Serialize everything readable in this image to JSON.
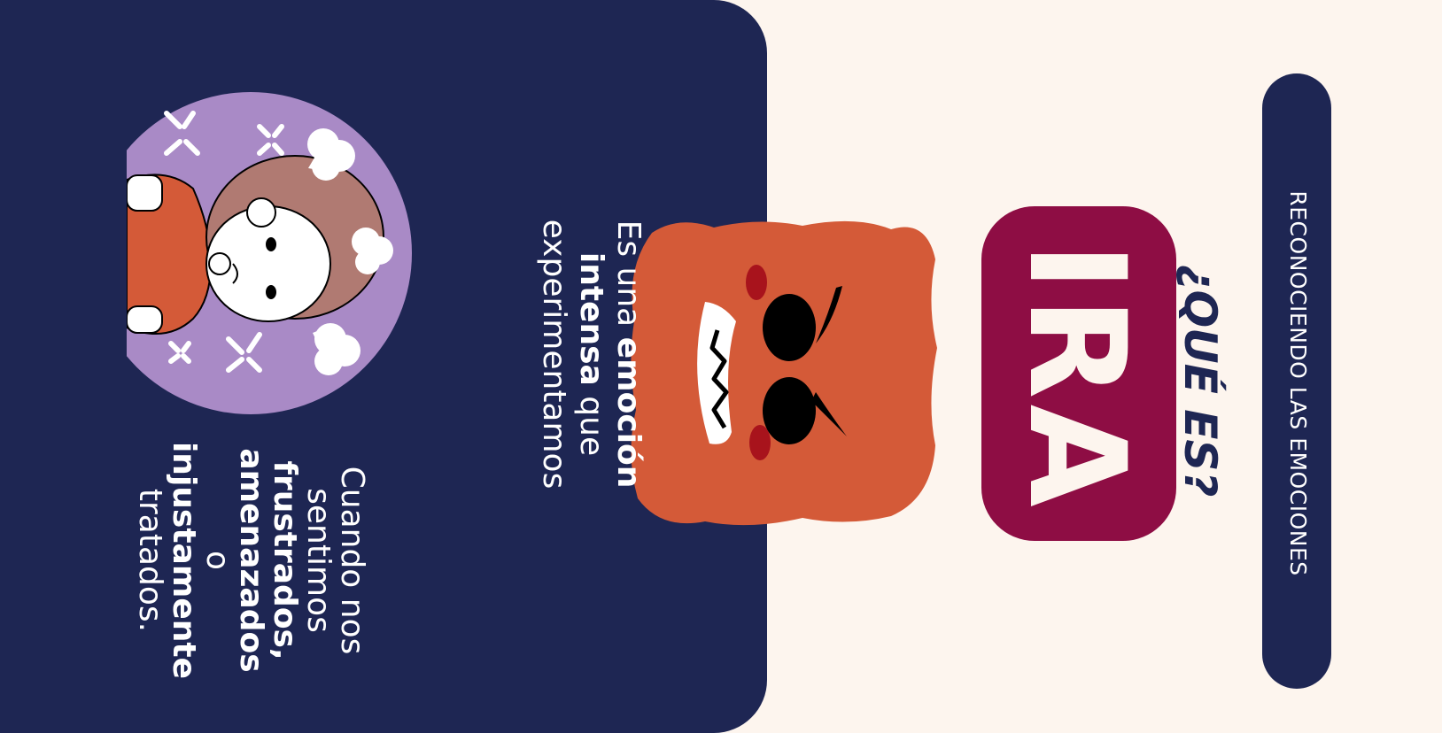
{
  "header": {
    "pill_label": "RECONOCIENDO LAS EMOCIONES",
    "question": "¿QUÉ ES?"
  },
  "emotion": {
    "name": "IRA"
  },
  "description": {
    "p1_a": "Es una ",
    "p1_b": "emoción intensa",
    "p1_c": " que experimentamos",
    "p2_a": "Cuando nos sentimos ",
    "p2_b": "frustrados, amenazados",
    "p2_c": " o ",
    "p2_d": "injustamente",
    "p2_e": " tratados."
  },
  "colors": {
    "background": "#fdf5ee",
    "panel": "#1e2653",
    "badge": "#8e0d44",
    "monster": "#d45a38",
    "avatar_bg": "#a98ac6"
  },
  "icons": [
    "angry-monster-icon",
    "angry-girl-icon",
    "anger-symbol-icon",
    "steam-cloud-icon"
  ]
}
